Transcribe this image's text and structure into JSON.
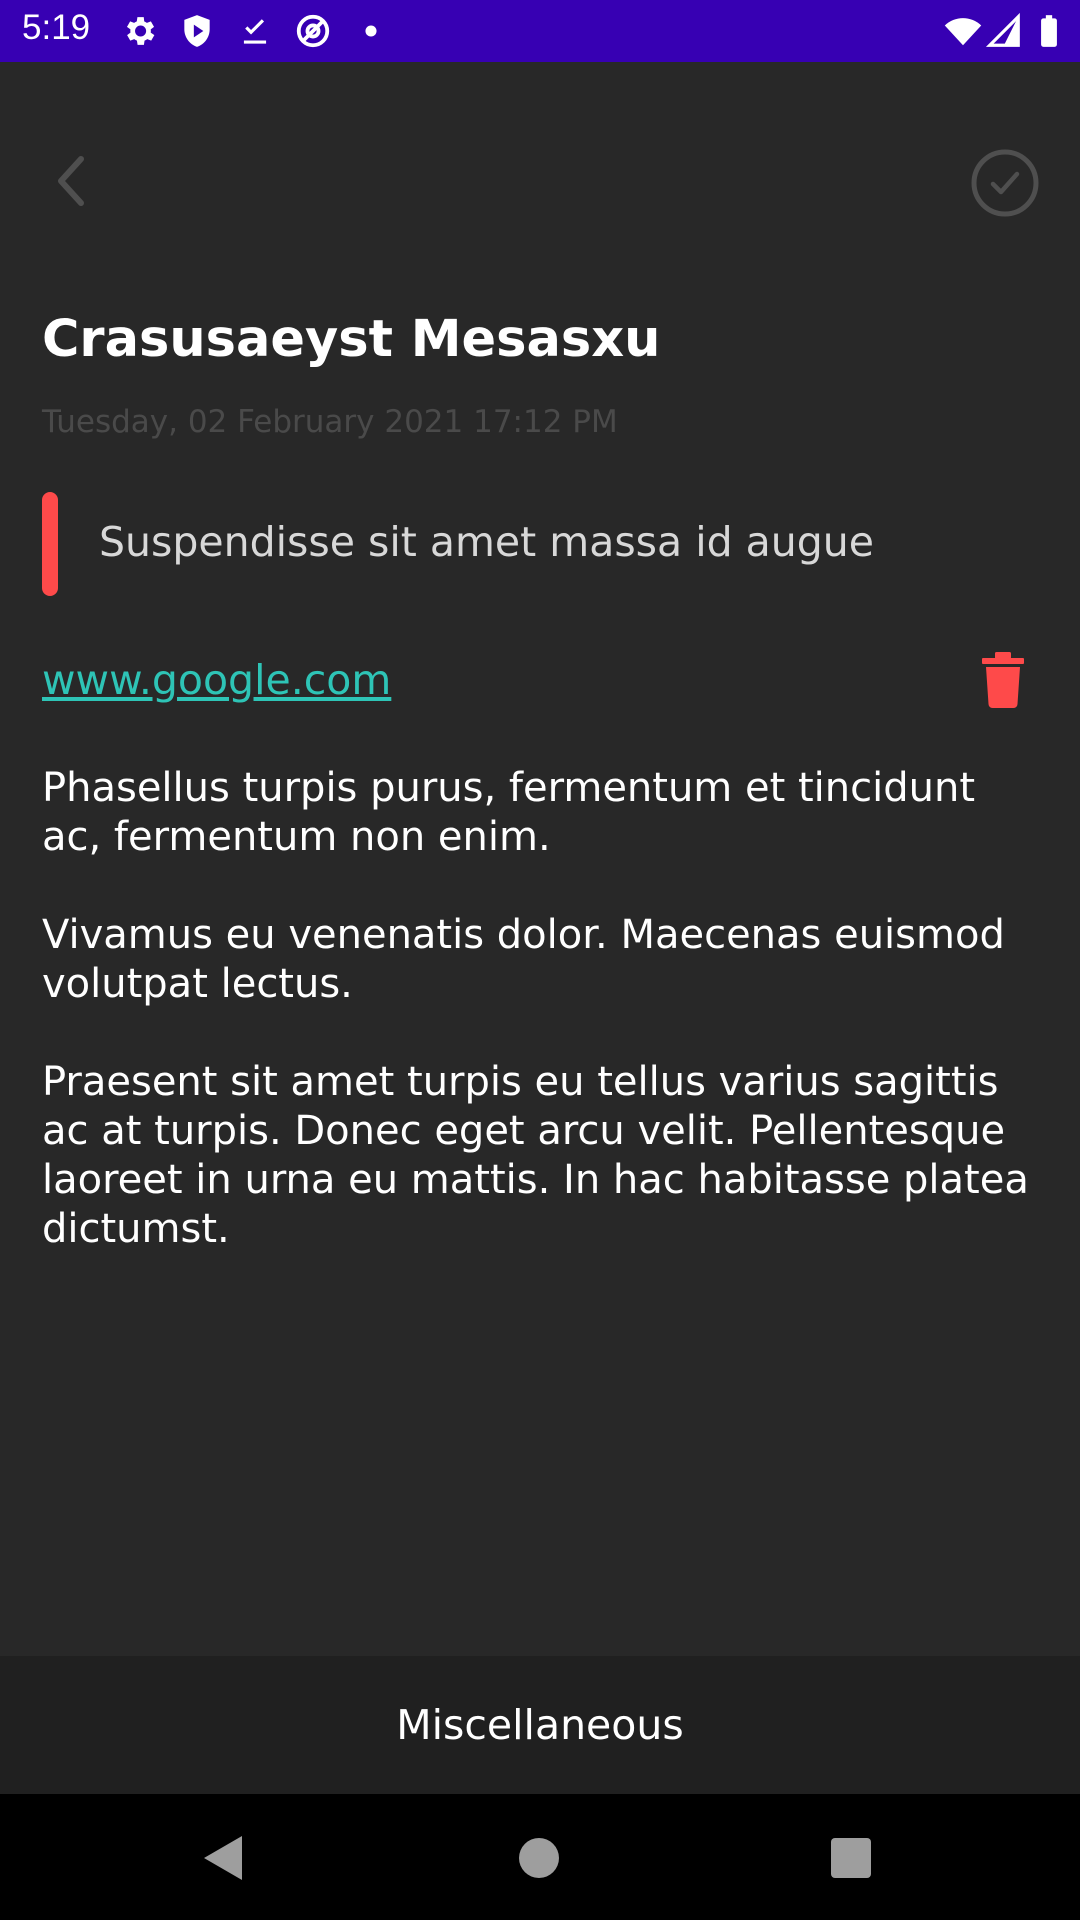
{
  "status_bar": {
    "time": "5:19",
    "icons": [
      "settings-icon",
      "shield-play-icon",
      "download-done-icon",
      "at-sign-icon",
      "dot-icon",
      "wifi-icon",
      "signal-icon",
      "battery-icon"
    ],
    "background": "#3700b3"
  },
  "header": {
    "back_icon": "chevron-left-icon",
    "done_icon": "check-circle-icon"
  },
  "note": {
    "title": "Crasusaeyst Mesasxu",
    "date": "Tuesday, 02 February 2021 17:12 PM",
    "subtitle": "Suspendisse sit amet massa id augue",
    "subtitle_indicator_color": "#fe4a4a",
    "web_url": "www.google.com",
    "web_url_color": "#2ec4b6",
    "delete_icon": "trash-icon",
    "delete_icon_color": "#fe4a4a",
    "body": [
      "Phasellus turpis purus, fermentum et tincidunt ac, fermentum non enim.",
      "Vivamus eu venenatis dolor. Maecenas euismod volutpat lectus.",
      "Praesent sit amet turpis eu tellus varius sagittis ac at turpis. Donec eget arcu velit. Pellentesque laoreet in urna eu mattis. In hac habitasse platea dictumst."
    ]
  },
  "category": {
    "label": "Miscellaneous"
  },
  "nav_bar": {
    "back_icon": "nav-back-icon",
    "home_icon": "nav-home-icon",
    "recents_icon": "nav-recents-icon"
  }
}
